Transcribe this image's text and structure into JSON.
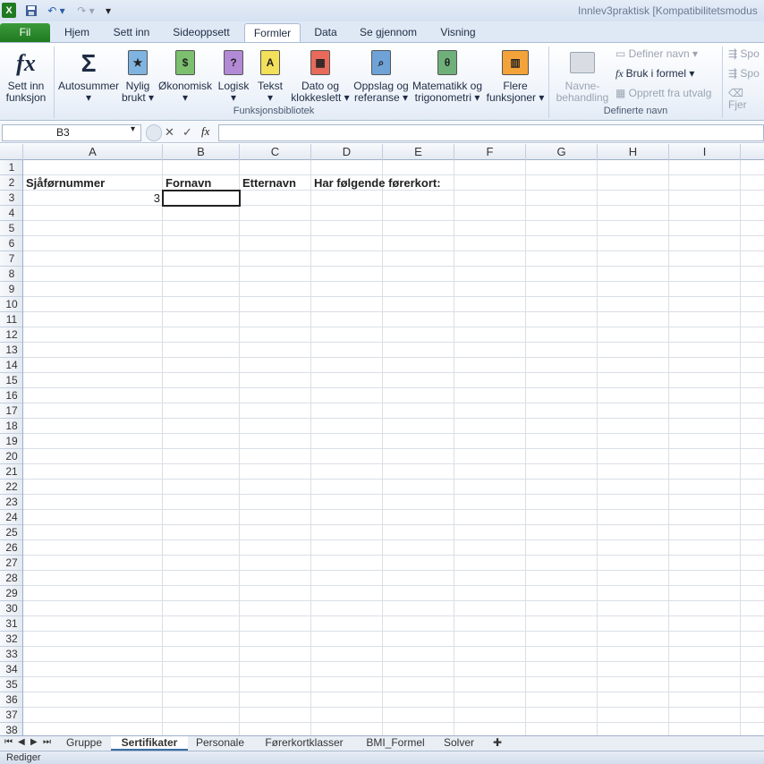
{
  "window": {
    "title": "Innlev3praktisk  [Kompatibilitetsmodus"
  },
  "tabs": {
    "file": "Fil",
    "items": [
      "Hjem",
      "Sett inn",
      "Sideoppsett",
      "Formler",
      "Data",
      "Se gjennom",
      "Visning"
    ],
    "active": "Formler"
  },
  "ribbon": {
    "insert_function": {
      "line1": "Sett inn",
      "line2": "funksjon"
    },
    "autosum": {
      "line1": "Autosummer",
      "line2": "▾"
    },
    "recent": {
      "line1": "Nylig",
      "line2": "brukt ▾"
    },
    "financial": {
      "line1": "Økonomisk",
      "line2": "▾"
    },
    "logical": {
      "line1": "Logisk",
      "line2": "▾"
    },
    "text": {
      "line1": "Tekst",
      "line2": "▾"
    },
    "datetime": {
      "line1": "Dato og",
      "line2": "klokkeslett ▾"
    },
    "lookup": {
      "line1": "Oppslag og",
      "line2": "referanse ▾"
    },
    "math": {
      "line1": "Matematikk og",
      "line2": "trigonometri ▾"
    },
    "more": {
      "line1": "Flere",
      "line2": "funksjoner ▾"
    },
    "library_label": "Funksjonsbibliotek",
    "name_manager": {
      "line1": "Navne-",
      "line2": "behandling"
    },
    "define_name": "Definer navn ▾",
    "use_in_formula": "Bruk i formel ▾",
    "create_from_selection": "Opprett fra utvalg",
    "defined_names_label": "Definerte navn",
    "audit": [
      "Spo",
      "Spo",
      "Fjer"
    ]
  },
  "formula_bar": {
    "name_box": "B3",
    "value": ""
  },
  "columns": [
    "A",
    "B",
    "C",
    "D",
    "E",
    "F",
    "G",
    "H",
    "I"
  ],
  "rows": [
    "1",
    "2",
    "3",
    "4",
    "5",
    "6",
    "7",
    "8",
    "9",
    "10",
    "11",
    "12",
    "13",
    "14",
    "15",
    "16",
    "17",
    "18",
    "19",
    "20",
    "21",
    "22",
    "23",
    "24",
    "25",
    "26",
    "27",
    "28",
    "29",
    "30",
    "31",
    "32",
    "33",
    "34",
    "35",
    "36",
    "37",
    "38"
  ],
  "cells": {
    "A2": "Sjåførnummer",
    "B2": "Fornavn",
    "C2": "Etternavn",
    "D2": "Har følgende førerkort:",
    "A3": "3"
  },
  "sheets": {
    "items": [
      "Gruppe",
      "Sertifikater",
      "Personale",
      "Førerkortklasser",
      "BMI_Formel",
      "Solver"
    ],
    "active": "Sertifikater"
  },
  "status": {
    "mode": "Rediger"
  },
  "icons": {
    "excel": "excel-logo-icon",
    "save": "save-icon",
    "undo": "undo-icon",
    "redo": "redo-icon",
    "fx": "fx-icon",
    "sigma": "sigma-icon"
  }
}
